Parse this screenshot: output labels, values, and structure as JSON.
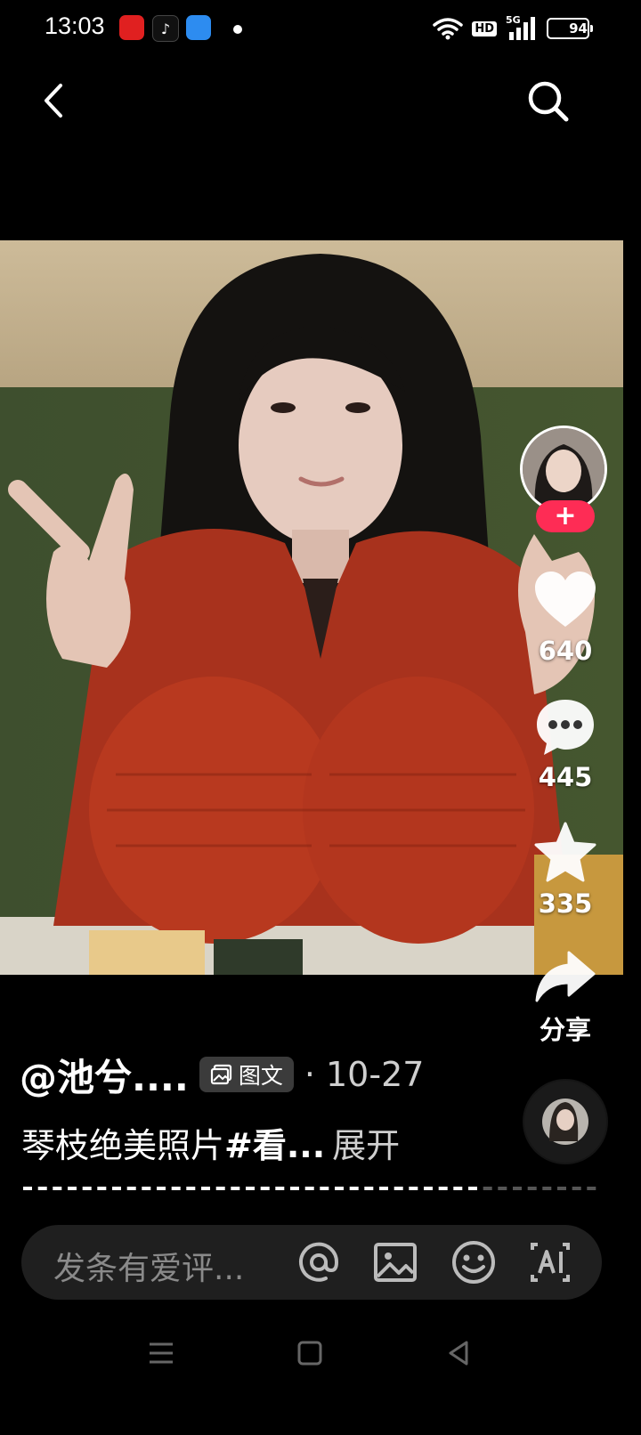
{
  "status_bar": {
    "time": "13:03",
    "network": "5G",
    "hd": "HD",
    "battery": "94",
    "battery_level_percent": 94
  },
  "header": {
    "back_icon": "chevron-left-icon",
    "search_icon": "search-icon"
  },
  "actions": {
    "likes": "640",
    "comments": "445",
    "favorites": "335",
    "share_label": "分享"
  },
  "post": {
    "author": "@池兮....",
    "type_label": "图文",
    "date": "· 10-27",
    "caption": "琴枝绝美照片",
    "hashtag": "#看...",
    "expand_label": "展开"
  },
  "comment_bar": {
    "placeholder": "发条有爱评..."
  },
  "colors": {
    "accent": "#fe2c55",
    "background": "#000000"
  }
}
